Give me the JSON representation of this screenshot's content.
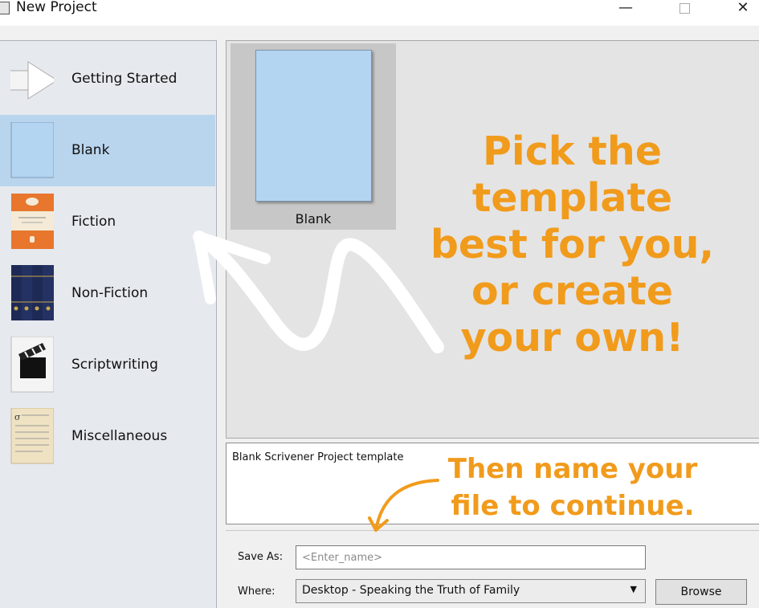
{
  "window": {
    "title": "New Project",
    "minimize_label": "—",
    "close_label": "✕"
  },
  "sidebar": {
    "items": [
      {
        "label": "Getting Started",
        "icon": "arrow-icon"
      },
      {
        "label": "Blank",
        "icon": "blank-page-icon",
        "selected": true
      },
      {
        "label": "Fiction",
        "icon": "fiction-book-icon"
      },
      {
        "label": "Non-Fiction",
        "icon": "books-icon"
      },
      {
        "label": "Scriptwriting",
        "icon": "clapperboard-icon"
      },
      {
        "label": "Miscellaneous",
        "icon": "parchment-icon"
      }
    ]
  },
  "templates": {
    "items": [
      {
        "label": "Blank",
        "selected": true
      }
    ]
  },
  "description": {
    "text": "Blank Scrivener Project template"
  },
  "form": {
    "save_as_label": "Save As:",
    "save_as_value": "",
    "save_as_placeholder": "<Enter_name>",
    "where_label": "Where:",
    "where_value": "Desktop - Speaking the Truth of Family",
    "browse_label": "Browse"
  },
  "annotations": {
    "main_lines": [
      "Pick the",
      "template",
      "best for you,",
      "or create",
      "your own!"
    ],
    "sub_lines": [
      "Then name your",
      "file to continue."
    ],
    "color": "#f19b1c"
  },
  "colors": {
    "selection": "#b9d5ee",
    "blank_doc": "#b3d5f2"
  }
}
